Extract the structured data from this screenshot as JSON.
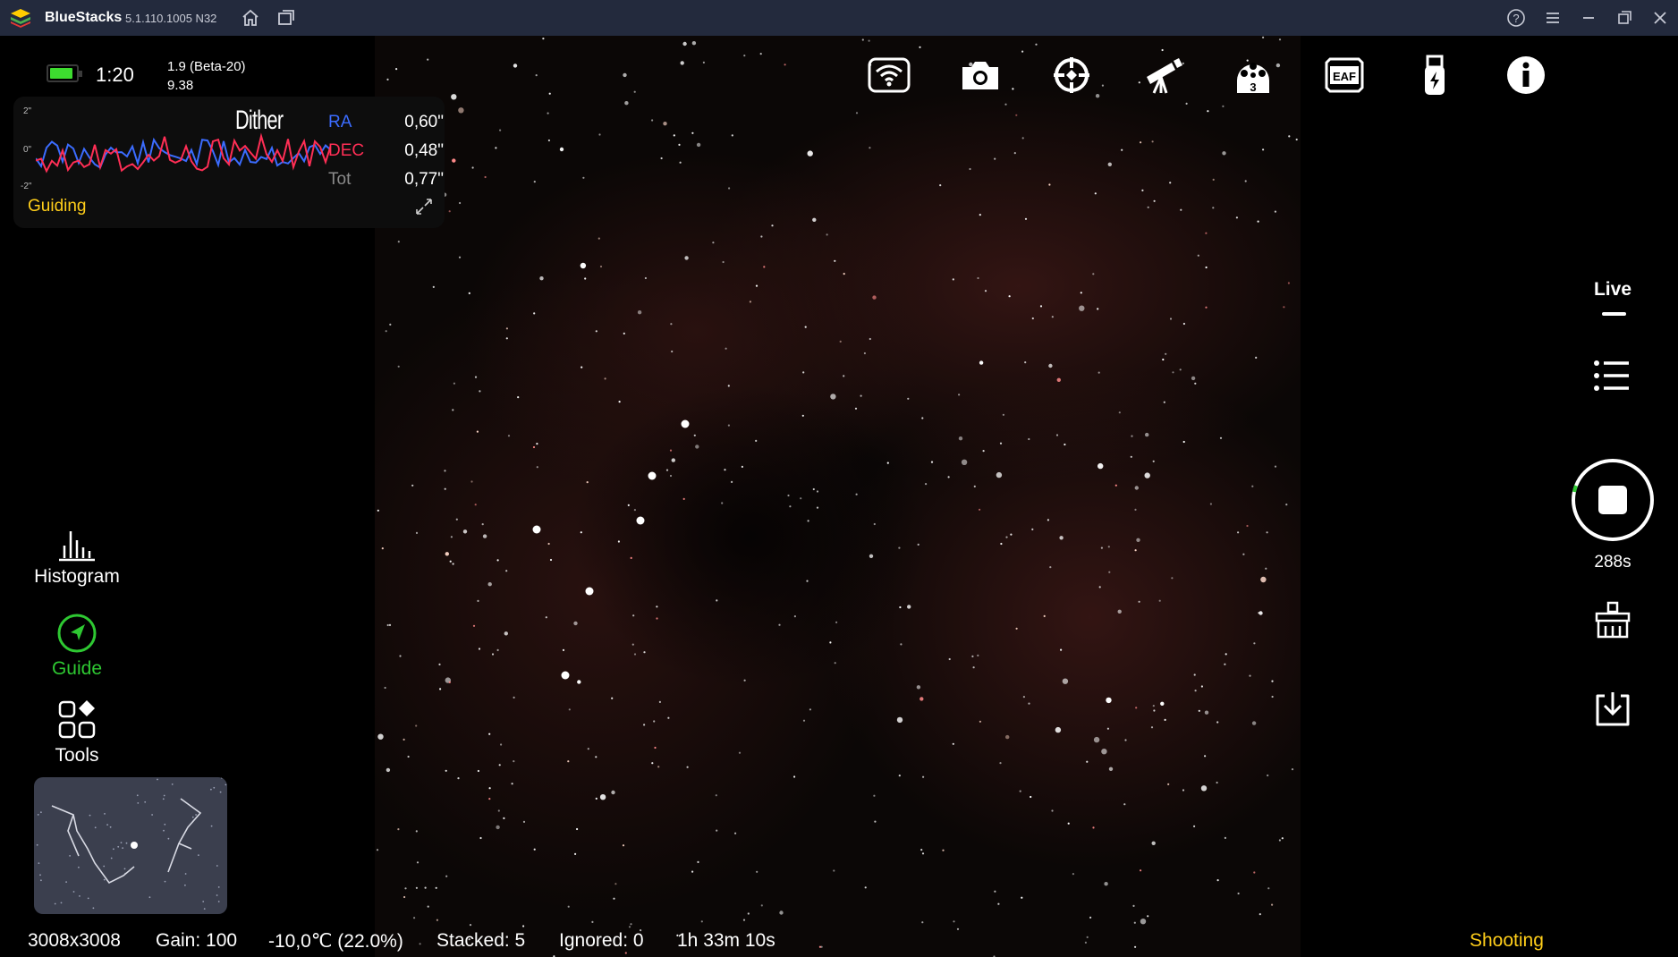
{
  "titlebar": {
    "app_name": "BlueStacks",
    "version": "5.1.110.1005  N32",
    "icons": [
      "bluestacks-logo-icon",
      "home-icon",
      "multi-instance-icon",
      "help-icon",
      "menu-icon",
      "minimize-icon",
      "restore-icon",
      "close-icon"
    ]
  },
  "status": {
    "battery_level": 0.9,
    "battery_color": "#3ddc2f",
    "time": "1:20",
    "firmware": "1.9 (Beta-20)",
    "version_num": "9.38"
  },
  "guide_graph": {
    "axis_top": "2\"",
    "axis_mid": "0\"",
    "axis_bottom": "-2\"",
    "dither_label": "Dither",
    "ra_label": "RA",
    "ra_value": "0,60\"",
    "dec_label": "DEC",
    "dec_value": "0,48\"",
    "tot_label": "Tot",
    "tot_value": "0,77\"",
    "status": "Guiding",
    "ra_color": "#3b6cff",
    "dec_color": "#ff2e55"
  },
  "top_toolbar": {
    "icons": [
      "wifi-icon",
      "camera-icon",
      "guide-target-icon",
      "telescope-icon",
      "filter-wheel-icon",
      "eaf-icon",
      "usb-power-icon",
      "info-icon"
    ],
    "filter_wheel_slot": "3",
    "eaf_label": "EAF"
  },
  "left_menu": {
    "histogram": "Histogram",
    "guide": "Guide",
    "tools": "Tools",
    "guide_color": "#2ec832"
  },
  "right_bar": {
    "live": "Live",
    "exposure_remaining": "288s"
  },
  "bottom_status": {
    "resolution": "3008x3008",
    "gain": "Gain: 100",
    "temperature": "-10,0℃  (22.0%)",
    "stacked": "Stacked: 5",
    "ignored": "Ignored: 0",
    "duration": "1h 33m 10s",
    "state": "Shooting",
    "state_color": "#ffce1a"
  }
}
